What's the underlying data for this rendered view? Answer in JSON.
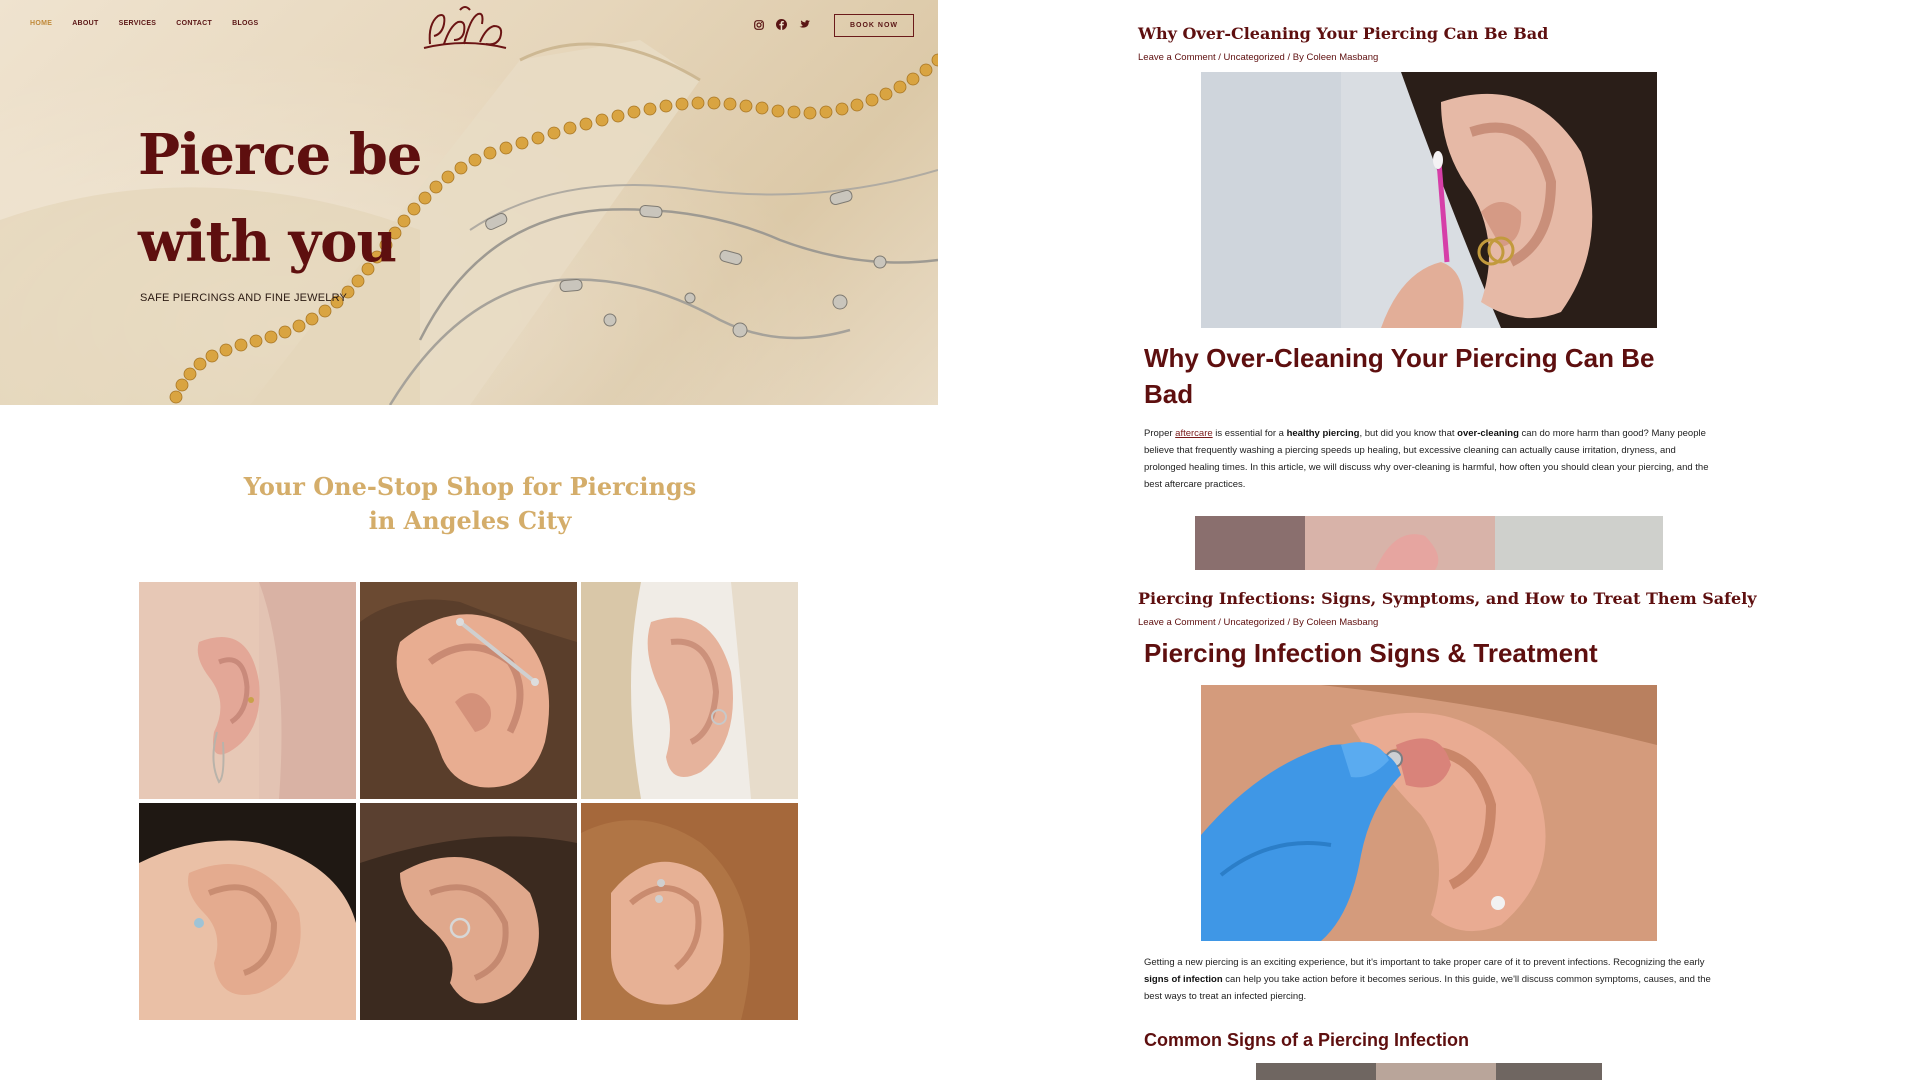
{
  "nav": {
    "items": [
      {
        "label": "HOME",
        "active": true
      },
      {
        "label": "ABOUT",
        "active": false
      },
      {
        "label": "SERVICES",
        "active": false
      },
      {
        "label": "CONTACT",
        "active": false
      },
      {
        "label": "BLOGS",
        "active": false
      }
    ],
    "social_icons": [
      "instagram-icon",
      "facebook-icon",
      "twitter-icon"
    ],
    "book_label": "BOOK NOW"
  },
  "hero": {
    "title_line1": "Pierce be",
    "title_line2": "with you",
    "subtitle": "SAFE PIERCINGS AND FINE JEWELRY"
  },
  "section": {
    "title_line1": "Your One-Stop Shop for Piercings",
    "title_line2": "in Angeles City"
  },
  "gallery": {
    "tiles": [
      "ear-photo-1",
      "ear-photo-2",
      "ear-photo-3",
      "ear-photo-4",
      "ear-photo-5",
      "ear-photo-6"
    ]
  },
  "posts": [
    {
      "title": "Why Over-Cleaning Your Piercing Can Be Bad",
      "meta_comment": "Leave a Comment",
      "meta_category": "Uncategorized",
      "meta_by": "By Coleen Masbang",
      "heading_line1": "Why Over-Cleaning Your Piercing Can Be",
      "heading_line2": "Bad",
      "p1_a": "Proper ",
      "p1_link": "aftercare",
      "p1_b": " is essential for a ",
      "p1_bold1": "healthy piercing",
      "p1_c": ", but did you know that ",
      "p1_bold2": "over-cleaning",
      "p1_d": " can do more harm than good? Many people believe that frequently washing a piercing speeds up healing, but excessive cleaning can actually cause irritation, dryness, and prolonged healing times. In this article, we will discuss why over-cleaning is harmful, how often you should clean your piercing, and the best aftercare practices."
    },
    {
      "title": "Piercing Infections: Signs, Symptoms, and How to Treat Them Safely",
      "meta_comment": "Leave a Comment",
      "meta_category": "Uncategorized",
      "meta_by": "By Coleen Masbang",
      "heading": "Piercing Infection Signs & Treatment",
      "p1_a": "Getting a new piercing is an exciting experience, but it's important to take proper care of it to prevent infections. Recognizing the early ",
      "p1_bold": "signs of infection",
      "p1_b": " can help you take action before it becomes serious. In this guide, we'll discuss common symptoms, causes, and the best ways to treat an infected piercing.",
      "subheading": "Common Signs of a Piercing Infection"
    }
  ],
  "colors": {
    "maroon": "#5e0f0f",
    "gold": "#d4ad6a",
    "nav_active": "#c08a3a"
  }
}
